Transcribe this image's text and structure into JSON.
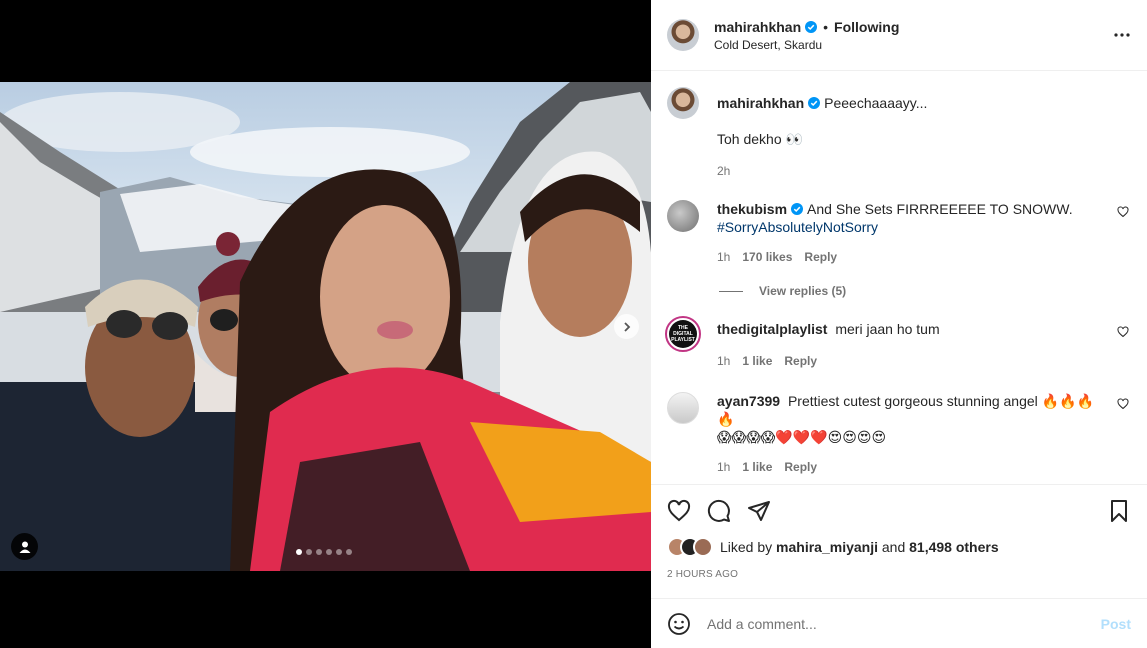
{
  "post": {
    "username": "mahirahkhan",
    "separator": "•",
    "follow_status": "Following",
    "location": "Cold Desert, Skardu",
    "carousel_count": 6,
    "carousel_active": 0
  },
  "caption": {
    "username": "mahirahkhan",
    "line1": "Peeechaaaayy...",
    "line2": "Toh dekho 👀",
    "age": "2h"
  },
  "comments": [
    {
      "username": "thekubism",
      "verified": true,
      "text": "And She Sets FIRRREEEEE TO SNOWW.",
      "hashtag": "#SorryAbsolutelyNotSorry",
      "age": "1h",
      "likes": "170 likes",
      "reply": "Reply",
      "view_replies": "View replies (5)"
    },
    {
      "username": "thedigitalplaylist",
      "verified": false,
      "text": "meri jaan ho tum",
      "age": "1h",
      "likes": "1 like",
      "reply": "Reply",
      "avatar_text": "THE DIGITAL PLAYLIST"
    },
    {
      "username": "ayan7399",
      "verified": false,
      "text": "Prettiest cutest gorgeous stunning angel 🔥🔥🔥🔥",
      "text2": "😱😱😱😱❤️❤️❤️😍😍😍😍",
      "age": "1h",
      "likes": "1 like",
      "reply": "Reply"
    }
  ],
  "likes_line": {
    "prefix": "Liked by",
    "user": "mahira_miyanji",
    "joiner": "and",
    "others": "81,498 others"
  },
  "timestamp": "2 HOURS AGO",
  "add_comment": {
    "placeholder": "Add a comment...",
    "post_label": "Post"
  },
  "colors": {
    "verified": "#0095f6",
    "link": "#00376b",
    "post_disabled": "#b2dffc",
    "secondary_text": "#737373"
  }
}
